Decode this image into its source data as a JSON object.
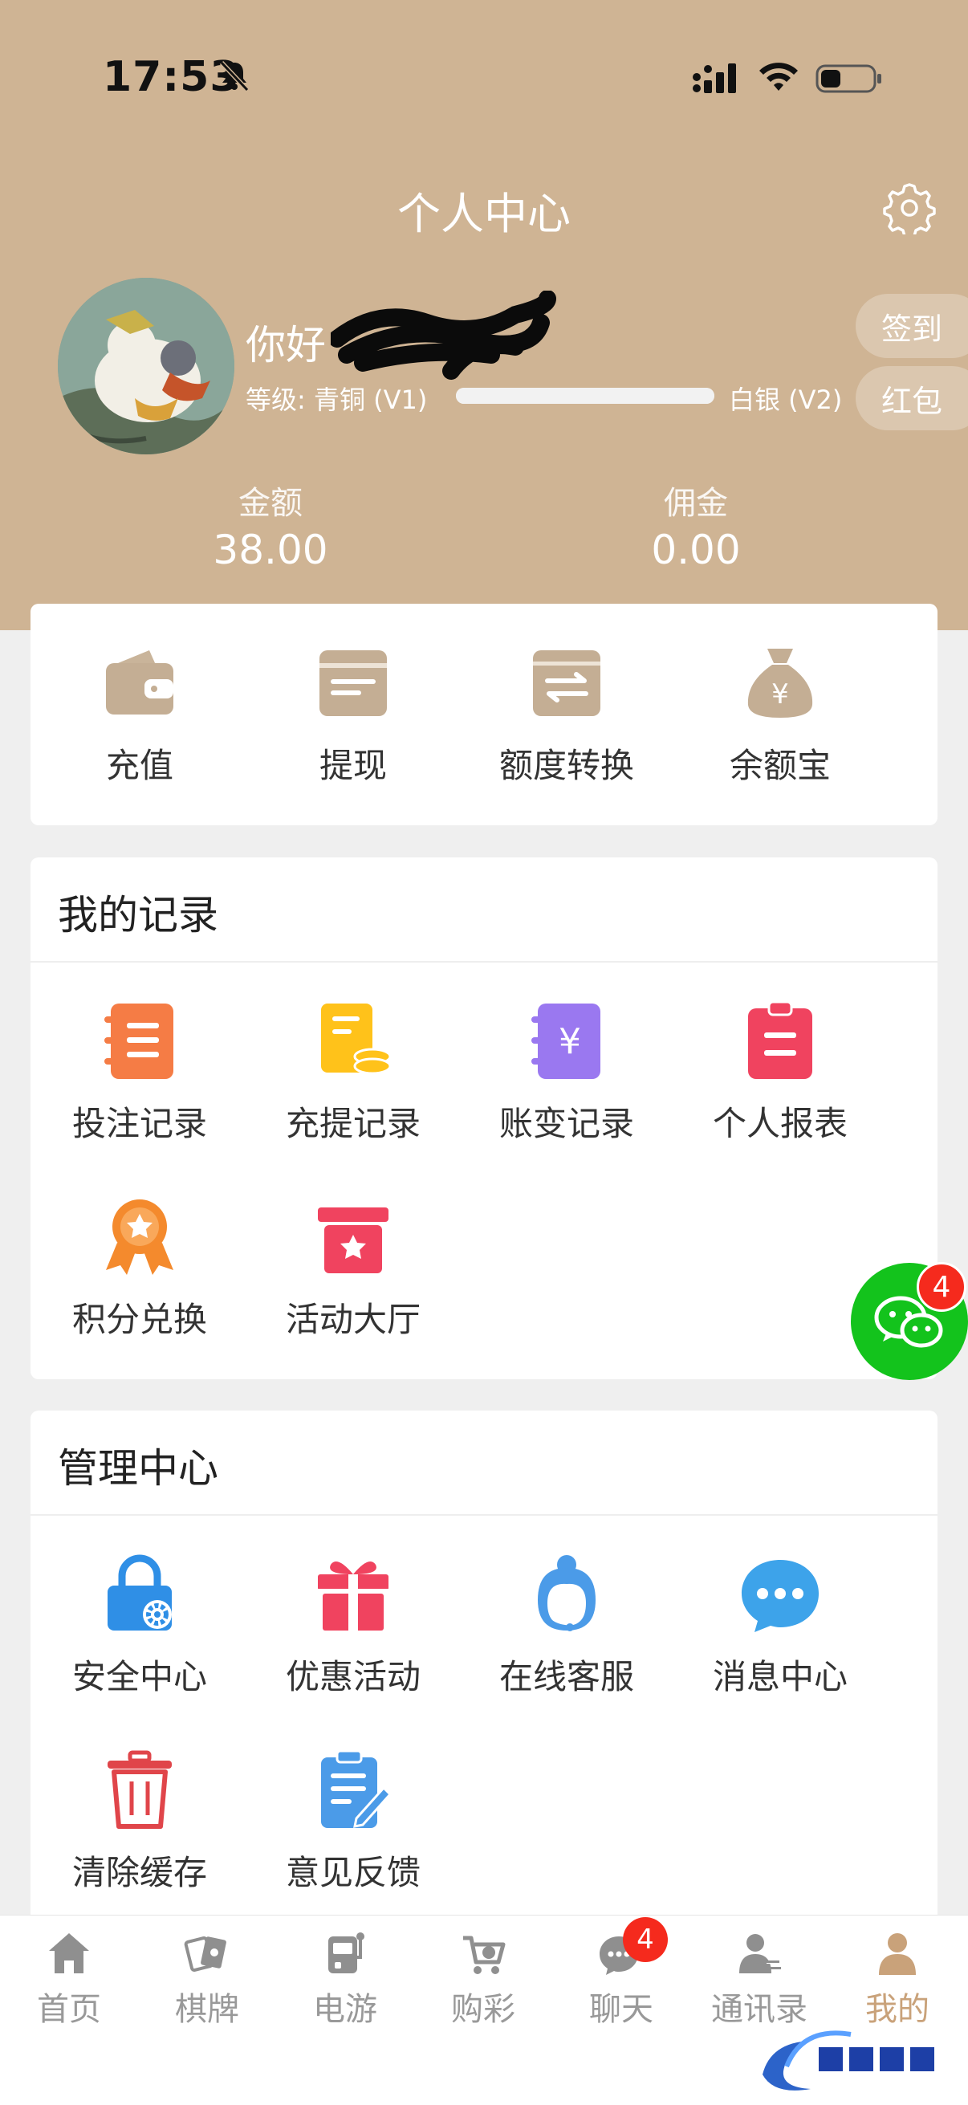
{
  "status_bar": {
    "time": "17:53"
  },
  "header": {
    "title": "个人中心",
    "greeting": "你好",
    "level_label": "等级: 青铜 (V1)",
    "next_level_label": "白银 (V2)",
    "level_progress": 1.0,
    "sign_in_label": "签到",
    "red_packet_label": "红包",
    "amount_label": "金额",
    "amount_value": "38.00",
    "commission_label": "佣金",
    "commission_value": "0.00"
  },
  "quick_actions": [
    {
      "label": "充值",
      "icon": "wallet-icon"
    },
    {
      "label": "提现",
      "icon": "withdraw-card-icon"
    },
    {
      "label": "额度转换",
      "icon": "transfer-icon"
    },
    {
      "label": "余额宝",
      "icon": "money-bag-icon"
    }
  ],
  "records": {
    "title": "我的记录",
    "items": [
      {
        "label": "投注记录",
        "icon": "bet-record-icon"
      },
      {
        "label": "充提记录",
        "icon": "deposit-withdraw-record-icon"
      },
      {
        "label": "账变记录",
        "icon": "account-change-icon"
      },
      {
        "label": "个人报表",
        "icon": "report-icon"
      },
      {
        "label": "积分兑换",
        "icon": "medal-icon"
      },
      {
        "label": "活动大厅",
        "icon": "gift-box-icon"
      }
    ]
  },
  "manage": {
    "title": "管理中心",
    "items": [
      {
        "label": "安全中心",
        "icon": "lock-gear-icon"
      },
      {
        "label": "优惠活动",
        "icon": "gift-icon"
      },
      {
        "label": "在线客服",
        "icon": "customer-service-icon"
      },
      {
        "label": "消息中心",
        "icon": "chat-bubble-icon"
      },
      {
        "label": "清除缓存",
        "icon": "trash-icon"
      },
      {
        "label": "意见反馈",
        "icon": "feedback-icon"
      }
    ]
  },
  "wechat_badge": "4",
  "tabbar": {
    "tabs": [
      {
        "label": "首页",
        "icon": "home-icon"
      },
      {
        "label": "棋牌",
        "icon": "cards-icon"
      },
      {
        "label": "电游",
        "icon": "slot-machine-icon"
      },
      {
        "label": "购彩",
        "icon": "cart-icon"
      },
      {
        "label": "聊天",
        "icon": "chat-icon"
      },
      {
        "label": "通讯录",
        "icon": "contacts-icon"
      },
      {
        "label": "我的",
        "icon": "profile-icon"
      }
    ],
    "chat_badge": "4",
    "active_tab": "我的"
  },
  "colors": {
    "header_bg": "#cfb494",
    "accent": "#c9a27a",
    "wechat_green": "#13c31c",
    "badge_red": "#f52a1d"
  }
}
